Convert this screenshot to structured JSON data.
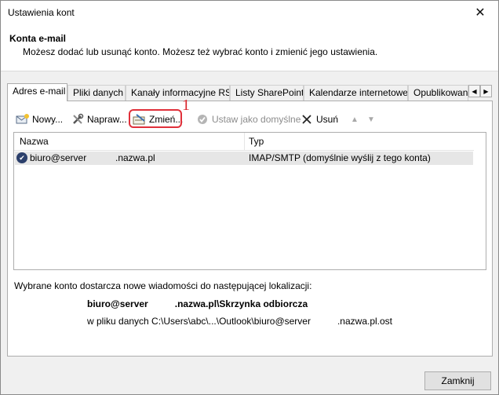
{
  "window": {
    "title": "Ustawienia kont",
    "close_glyph": "✕"
  },
  "header": {
    "title": "Konta e-mail",
    "subtitle": "Możesz dodać lub usunąć konto. Możesz też wybrać konto i zmienić jego ustawienia."
  },
  "tabs": [
    {
      "label": "Adres e-mail",
      "active": true
    },
    {
      "label": "Pliki danych"
    },
    {
      "label": "Kanały informacyjne RSS"
    },
    {
      "label": "Listy SharePoint"
    },
    {
      "label": "Kalendarze internetowe"
    },
    {
      "label": "Opublikowane kalendarze"
    }
  ],
  "tab_scroll": {
    "left": "◀",
    "right": "▶"
  },
  "toolbar": {
    "new_label": "Nowy...",
    "repair_label": "Napraw...",
    "change_label": "Zmień...",
    "set_default_label": "Ustaw jako domyślne",
    "remove_label": "Usuń",
    "up_glyph": "▲",
    "down_glyph": "▼",
    "annotation_number": "1"
  },
  "accounts_table": {
    "headers": {
      "name": "Nazwa",
      "type": "Typ"
    },
    "rows": [
      {
        "name_part1": "biuro@server",
        "name_part2": ".nazwa.pl",
        "type": "IMAP/SMTP (domyślnie wyślij z tego konta)"
      }
    ]
  },
  "delivery": {
    "info": "Wybrane konto dostarcza nowe wiadomości do następującej lokalizacji:",
    "location_part1": "biuro@server",
    "location_part2": ".nazwa.pl\\Skrzynka odbiorcza",
    "file_part1": "w pliku danych C:\\Users\\abc\\...\\Outlook\\biuro@server",
    "file_part2": ".nazwa.pl.ost"
  },
  "footer": {
    "close_label": "Zamknij"
  }
}
